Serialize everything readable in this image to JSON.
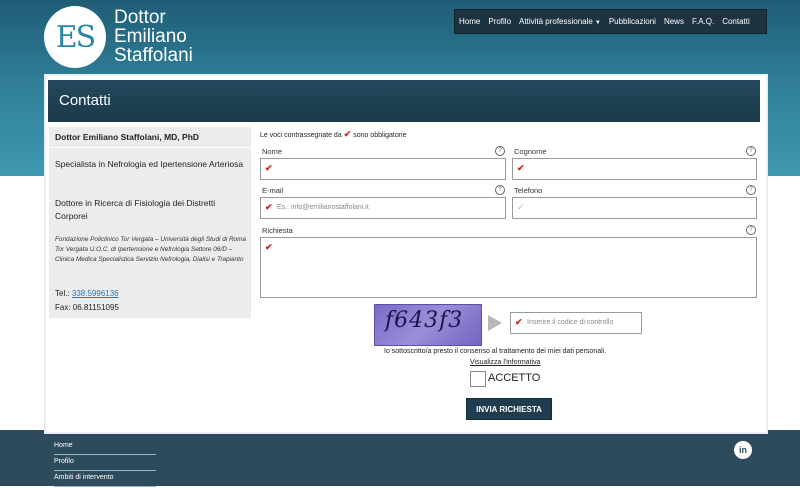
{
  "site": {
    "logo_initials": "ES",
    "logo_line1": "Dottor",
    "logo_line2": "Emiliano",
    "logo_line3": "Staffolani"
  },
  "nav": {
    "items": [
      "Home",
      "Profilo",
      "Attività professionale",
      "Pubblicazioni",
      "News",
      "F.A.Q.",
      "Contatti"
    ]
  },
  "page": {
    "title": "Contatti"
  },
  "sidebar": {
    "name": "Dottor Emiliano Staffolani, MD, PhD",
    "spec1": "Specialista in Nefrologia ed Ipertensione Arteriosa",
    "spec2": "Dottore in Ricerca di Fisiologia dei Distretti Corporei",
    "institution": "Fondazione Policlinico Tor Vergata – Università degli Studi di Roma Tor Vergata U.O.C. di Ipertensione e Nefrologia Settore 06/D – Clinica Medica Specialistica Servizio Nefrologia, Dialisi e Trapianto",
    "tel_label": "Tel.:",
    "tel_value": "338.5996136",
    "fax": "Fax: 06.81151095"
  },
  "form": {
    "required_note_pre": "Le voci contrassegnate da",
    "required_note_post": "sono obbligatorie",
    "nome_label": "Nome",
    "cognome_label": "Cognome",
    "email_label": "E-mail",
    "email_placeholder": "Es.: info@emilianostaffolani.it",
    "telefono_label": "Telefono",
    "richiesta_label": "Richiesta",
    "captcha_text": "f643f3",
    "captcha_placeholder": "Inserire il codice di controllo",
    "consent_text": "Io sottoscritto/a presto il consenso al trattamento dei miei dati personali.",
    "informativa_link": "Visualizza l'informativa",
    "accept_label": "ACCETTO",
    "submit_label": "INVIA RICHIESTA"
  },
  "footer": {
    "links": [
      "Home",
      "Profilo",
      "Ambiti di intervento"
    ],
    "social_icon": "linkedin-icon"
  },
  "colors": {
    "header_blue": "#2f7d97",
    "title_bar": "#1b3a4b",
    "footer": "#2e4a5d",
    "required_check": "#c62828"
  }
}
